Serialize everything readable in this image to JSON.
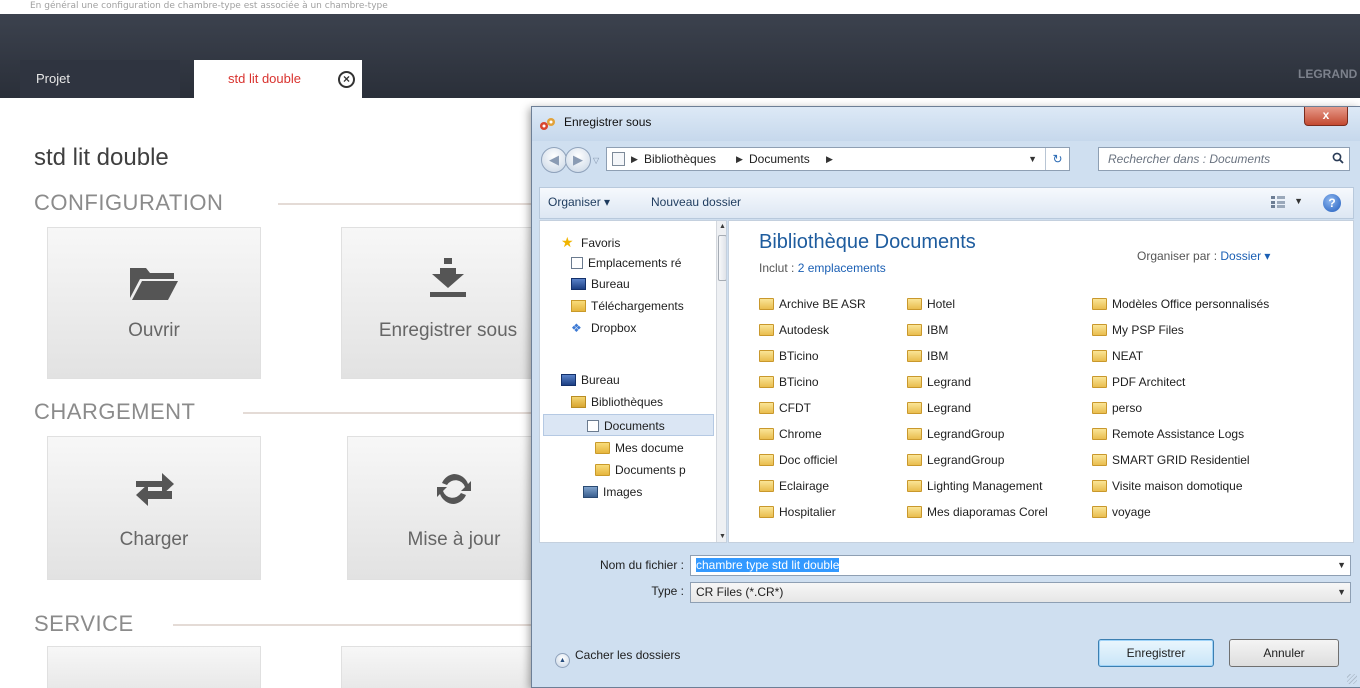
{
  "app": {
    "top_text": "En général une configuration de chambre-type est associée à un chambre-type",
    "tabs": [
      {
        "label": "Projet"
      },
      {
        "label": "std lit double",
        "close": "⊗"
      }
    ],
    "brand": "LEGRAND",
    "page_title": "std lit double",
    "sections": {
      "configuration": {
        "title": "CONFIGURATION",
        "tiles": [
          {
            "label": "Ouvrir",
            "icon": "folder-icon"
          },
          {
            "label": "Enregistrer sous",
            "icon": "download-icon"
          }
        ]
      },
      "chargement": {
        "title": "CHARGEMENT",
        "tiles": [
          {
            "label": "Charger",
            "icon": "transfer-arrows-icon"
          },
          {
            "label": "Mise à jour",
            "icon": "refresh-icon"
          }
        ]
      },
      "service": {
        "title": "SERVICE"
      }
    }
  },
  "dialog": {
    "title": "Enregistrer sous",
    "close": "x",
    "address": {
      "crumbs": [
        "Bibliothèques",
        "Documents"
      ]
    },
    "search_placeholder": "Rechercher dans : Documents",
    "toolbar": {
      "organize": "Organiser ▾",
      "new_folder": "Nouveau dossier",
      "help": "?"
    },
    "nav_items": [
      {
        "label": "Favoris",
        "icon": "star-icon"
      },
      {
        "label": "Emplacements ré",
        "icon": "recent-places-icon"
      },
      {
        "label": "Bureau",
        "icon": "desktop-icon"
      },
      {
        "label": "Téléchargements",
        "icon": "downloads-folder-icon"
      },
      {
        "label": "Dropbox",
        "icon": "dropbox-icon"
      },
      {
        "label": "Bureau",
        "icon": "desktop-icon"
      },
      {
        "label": "Bibliothèques",
        "icon": "libraries-icon"
      },
      {
        "label": "Documents",
        "icon": "documents-icon"
      },
      {
        "label": "Mes docume",
        "icon": "my-documents-icon"
      },
      {
        "label": "Documents p",
        "icon": "folder-icon"
      },
      {
        "label": "Images",
        "icon": "pictures-icon"
      }
    ],
    "library": {
      "title": "Bibliothèque Documents",
      "inclut_label": "Inclut :",
      "inclut_link": "2 emplacements",
      "org_par_label": "Organiser par :",
      "org_par_value": "Dossier ▾"
    },
    "files": {
      "col1": [
        "Archive BE ASR",
        "Autodesk",
        "BTicino",
        "BTicino",
        "CFDT",
        "Chrome",
        "Doc officiel",
        "Eclairage",
        "Hospitalier"
      ],
      "col2": [
        "Hotel",
        "IBM",
        "IBM",
        "Legrand",
        "Legrand",
        "LegrandGroup",
        "LegrandGroup",
        "Lighting Management",
        "Mes diaporamas Corel"
      ],
      "col3": [
        "Modèles Office personnalisés",
        "My PSP Files",
        "NEAT",
        "PDF Architect",
        "perso",
        "Remote Assistance Logs",
        "SMART GRID Residentiel",
        "Visite maison domotique",
        "voyage"
      ]
    },
    "filename_label": "Nom du fichier :",
    "filename_value": "chambre type std lit double",
    "type_label": "Type :",
    "type_value": "CR Files (*.CR*)",
    "hide_folders": "Cacher les dossiers",
    "save_button": "Enregistrer",
    "cancel_button": "Annuler"
  }
}
